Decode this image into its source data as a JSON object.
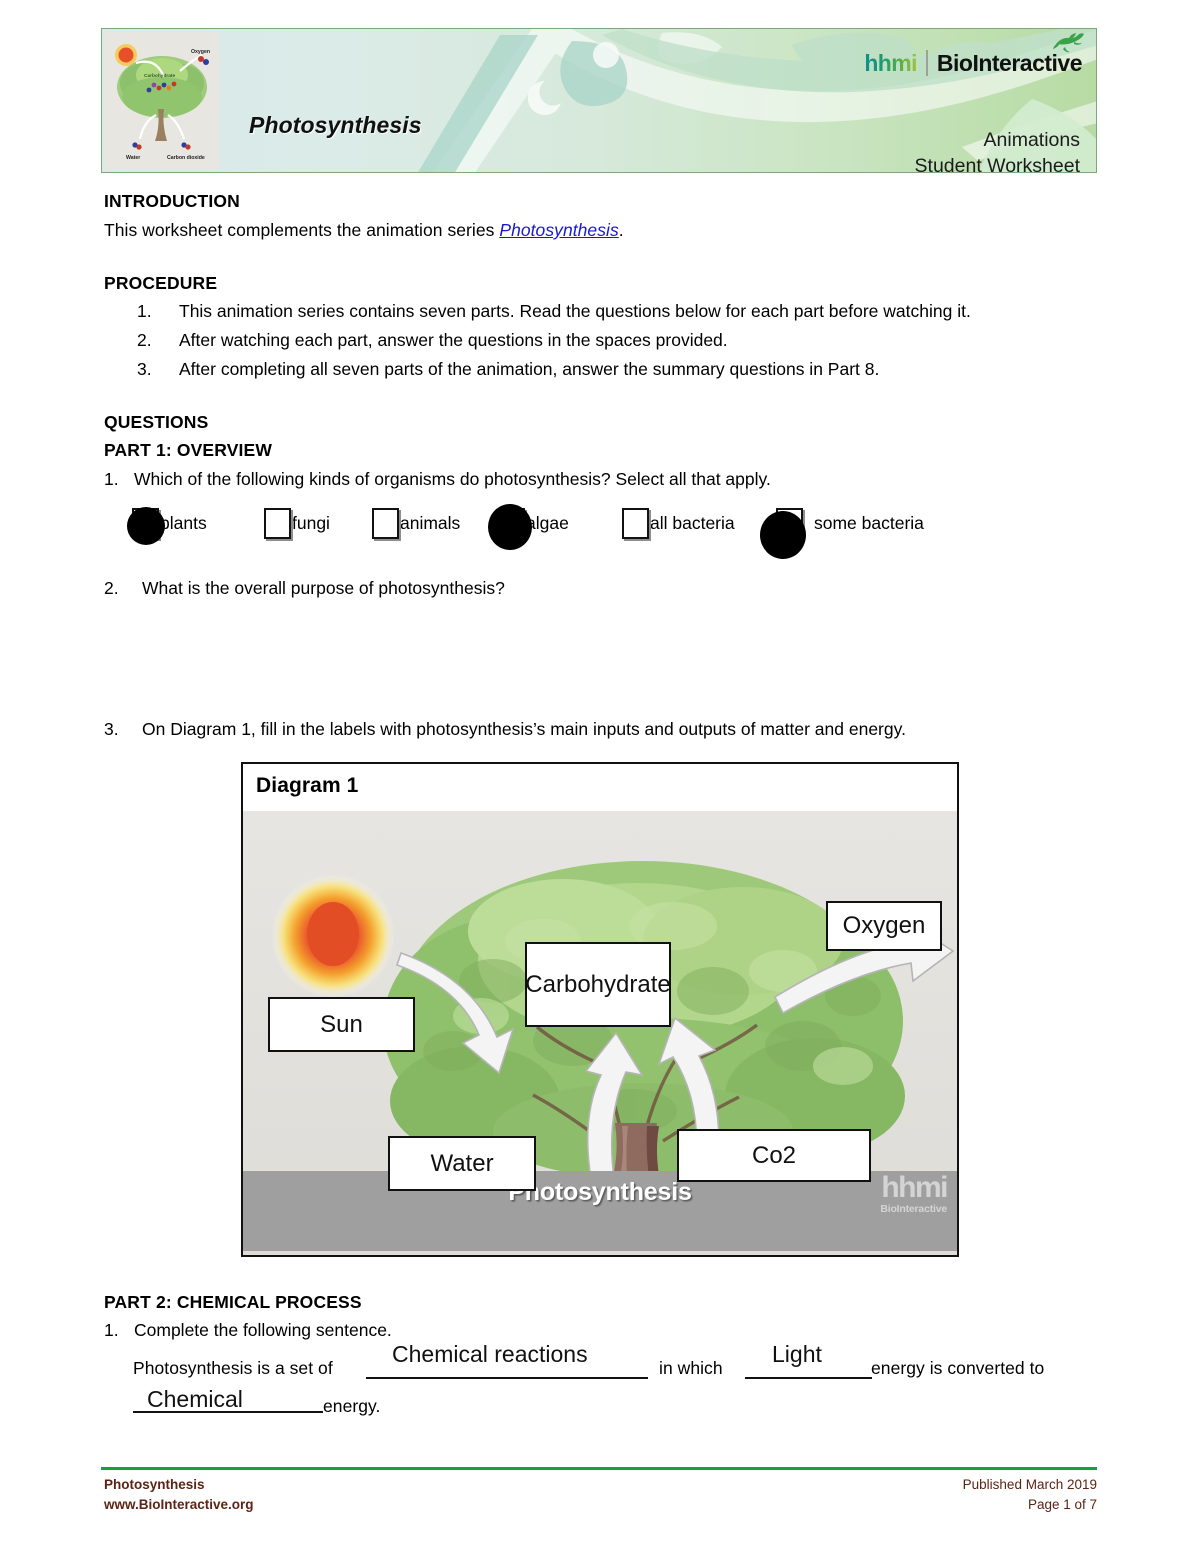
{
  "header": {
    "title": "Photosynthesis",
    "logo_hhmi": "hhmi",
    "logo_bio": "BioInteractive",
    "sub_line1": "Animations",
    "sub_line2": "Student Worksheet",
    "thumb_labels": {
      "oxygen": "Oxygen",
      "carbohydrate": "Carbohydrate",
      "water": "Water",
      "carbon_dioxide": "Carbon dioxide"
    },
    "colors": {
      "banner_left": "#d9eaea",
      "banner_right": "#b9dca6",
      "border": "#7ea77e",
      "hhmi_teal": "#0d8f8f",
      "hhmi_lime": "#9ec53a"
    }
  },
  "introduction": {
    "heading": "INTRODUCTION",
    "text_before": "This worksheet complements the animation series ",
    "link_text": "Photosynthesis",
    "text_after": "."
  },
  "procedure": {
    "heading": "PROCEDURE",
    "items": [
      {
        "num": "1.",
        "text": "This animation series contains seven parts. Read the questions below for each part before watching it."
      },
      {
        "num": "2.",
        "text": "After watching each part, answer the questions in the spaces provided."
      },
      {
        "num": "3.",
        "text": "After completing all seven parts of the animation, answer the summary questions in Part 8."
      }
    ]
  },
  "questions": {
    "heading": "QUESTIONS",
    "part1_heading": "PART 1: OVERVIEW",
    "q1": {
      "num": "1.",
      "text": "Which of the following kinds of organisms do photosynthesis? Select all that apply."
    },
    "q1_options": [
      {
        "label": "plants",
        "checked": true
      },
      {
        "label": "fungi",
        "checked": false
      },
      {
        "label": "animals",
        "checked": false
      },
      {
        "label": "algae",
        "checked": true
      },
      {
        "label": "all bacteria",
        "checked": false
      },
      {
        "label": "some bacteria",
        "checked": true
      }
    ],
    "q2": {
      "num": "2.",
      "text": "What is the overall purpose of photosynthesis?"
    },
    "q3": {
      "num": "3.",
      "text": "On Diagram 1, fill in the labels with photosynthesis’s main inputs and outputs of matter and energy."
    }
  },
  "diagram": {
    "title": "Diagram 1",
    "band_title": "Photosynthesis",
    "band_logo_top": "hhmi",
    "band_logo_bottom": "BioInteractive",
    "labels": {
      "sun": "Sun",
      "carbohydrate": "Carbohydrate",
      "oxygen": "Oxygen",
      "water": "Water",
      "co2": "Co2"
    }
  },
  "part2": {
    "heading": "PART 2: CHEMICAL PROCESS",
    "q1": {
      "num": "1.",
      "text": "Complete the following sentence."
    },
    "sentence": {
      "seg1": "Photosynthesis is a set of",
      "answer1": "Chemical reactions",
      "seg2": "in which",
      "answer2": "Light",
      "seg3": "energy is converted to",
      "answer3": "Chemical",
      "seg4": "energy."
    }
  },
  "footer": {
    "left_line1": "Photosynthesis",
    "left_line2": "www.BioInteractive.org",
    "right_line1": "Published March 2019",
    "right_line2": "Page 1 of 7",
    "rule_color": "#13a438",
    "text_color": "#5c2414"
  }
}
